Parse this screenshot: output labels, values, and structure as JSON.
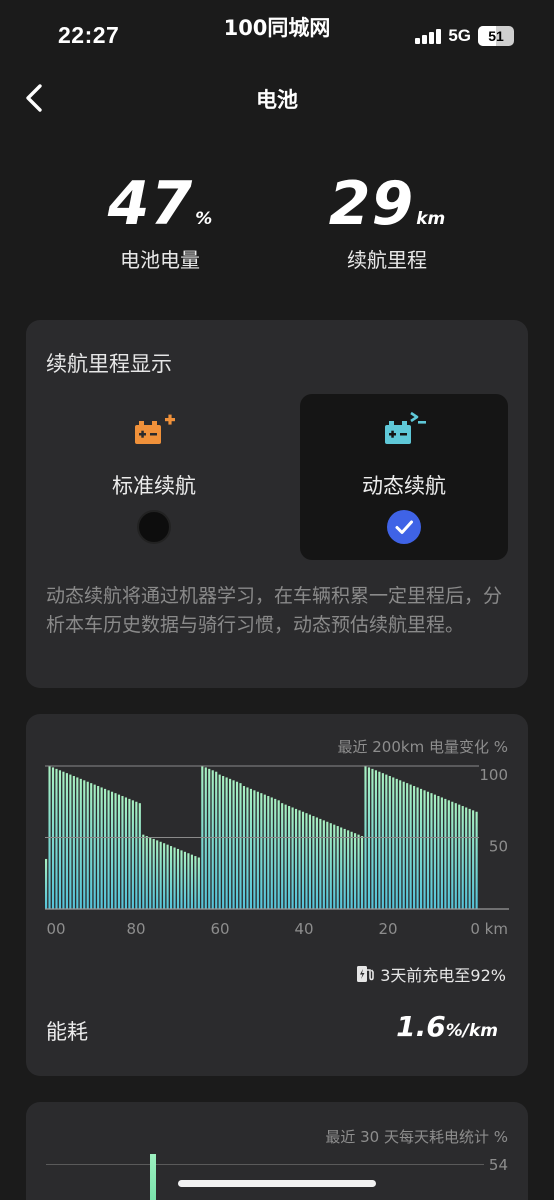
{
  "status_bar": {
    "time": "22:27",
    "carrier_center": "100同城网",
    "network": "5G",
    "battery_level": "51"
  },
  "nav": {
    "title": "电池",
    "back_icon": "chevron-left-icon"
  },
  "summary": {
    "battery_value": "47",
    "battery_unit": "%",
    "battery_label": "电池电量",
    "range_value": "29",
    "range_unit": "km",
    "range_label": "续航里程"
  },
  "range_display": {
    "title": "续航里程显示",
    "options": [
      {
        "label": "标准续航",
        "icon": "battery-plus-icon",
        "selected": false,
        "color": "#f0913a"
      },
      {
        "label": "动态续航",
        "icon": "battery-dynamic-icon",
        "selected": true,
        "color": "#5fc8d8"
      }
    ],
    "description": "动态续航将通过机器学习，在车辆积累一定里程后，分析本车历史数据与骑行习惯，动态预估续航里程。"
  },
  "chart_data": {
    "type": "bar",
    "title": "最近 200km 电量变化 %",
    "x_tick_labels": [
      "00",
      "80",
      "60",
      "40",
      "20",
      "0 km"
    ],
    "y_tick_labels": [
      "100",
      "50"
    ],
    "ylim": [
      0,
      100
    ],
    "x_direction": "reversed",
    "values": [
      35,
      100,
      99,
      98,
      97,
      96,
      95,
      94,
      93,
      92,
      91,
      90,
      89,
      88,
      87,
      86,
      85,
      84,
      83,
      82,
      81,
      80,
      79,
      78,
      77,
      76,
      75,
      74,
      52,
      51,
      50,
      49,
      48,
      47,
      46,
      45,
      44,
      43,
      42,
      41,
      40,
      39,
      38,
      37,
      36,
      100,
      99,
      98,
      97,
      96,
      94,
      93,
      92,
      91,
      90,
      89,
      88,
      86,
      85,
      84,
      83,
      82,
      81,
      80,
      79,
      78,
      77,
      76,
      74,
      73,
      72,
      71,
      70,
      69,
      68,
      67,
      66,
      65,
      64,
      63,
      62,
      61,
      60,
      59,
      58,
      57,
      56,
      55,
      54,
      53,
      52,
      51,
      100,
      99,
      98,
      97,
      96,
      95,
      94,
      93,
      92,
      91,
      90,
      89,
      88,
      87,
      86,
      85,
      84,
      83,
      82,
      81,
      80,
      79,
      78,
      77,
      76,
      75,
      74,
      73,
      72,
      71,
      70,
      69,
      68
    ],
    "gridlines": [
      100,
      50
    ],
    "bar_gradient": [
      "#a8f0c2",
      "#54c3d9"
    ]
  },
  "charge_note": {
    "icon": "charging-station-icon",
    "text": "3天前充电至92%"
  },
  "energy": {
    "label": "能耗",
    "value": "1.6",
    "unit": "%/km"
  },
  "daily": {
    "title": "最近 30 天每天耗电统计 %",
    "top_tick": "54",
    "bar_color": "#8ff0b8"
  }
}
